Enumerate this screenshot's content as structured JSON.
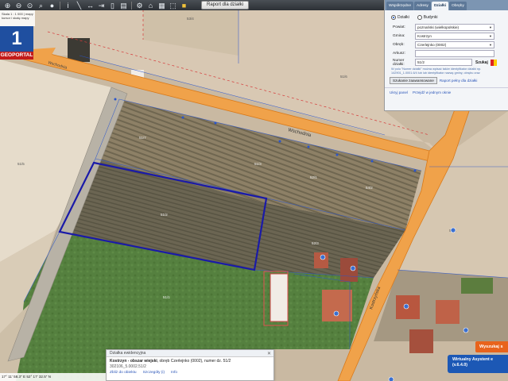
{
  "toolbar": {
    "tools": [
      "zoom-in-icon",
      "zoom-out-icon",
      "zoom-extent-icon",
      "zoom-window-icon",
      "pan-icon",
      "info-icon",
      "measure-icon",
      "area-icon",
      "draw-icon",
      "print-icon",
      "layers-icon",
      "settings-icon",
      "home-icon",
      "table-icon",
      "export-icon",
      "flag-icon"
    ],
    "report_label": "Raport dla działki"
  },
  "scale_strip": {
    "text": "Skala 1 : 1 000 | mapy kursor i skalę mapy"
  },
  "logo": {
    "number": "1",
    "text": "GEOPORTAL"
  },
  "panel": {
    "tabs": [
      "Współrzędne",
      "Adresy",
      "Działki",
      "Obręby"
    ],
    "active_tab": "Działki",
    "radio_options": [
      "Działki",
      "Budynki"
    ],
    "fields": [
      {
        "label": "Powiat:",
        "value": "poznański (wielkopolskie)"
      },
      {
        "label": "Gmina:",
        "value": "Kostrzyn"
      },
      {
        "label": "Obręb:",
        "value": "Czerlejnko (0002)"
      },
      {
        "label": "Arkusz:",
        "value": ""
      }
    ],
    "number_label": "Numer działki:",
    "number_value": "51/2",
    "search_label": "Szukaj",
    "note": "W polu \"Numer działki\" można wpisać także identyfikator działki np. 142901_1.0001.6/4 lub lub identyfikator nazwę gminy, obrębu oraz",
    "advanced_label": "Szukanie zaawansowane",
    "raport_link": "Raport pełny dla działki",
    "links": [
      "Ukryj panel",
      "Przejdź w jednym oknie"
    ]
  },
  "map_labels": {
    "road1": "Wschodnia",
    "road2": "Wschodnia",
    "road3": "Kostrzyńska",
    "parcels": [
      "51/7",
      "51/3",
      "54/2",
      "52/1",
      "51/2",
      "52/3",
      "51/1",
      "51/5",
      "51/6",
      "53/4",
      "53/1",
      "44/3",
      "38/3",
      "31/1",
      "36/2",
      "4/2",
      "51/4",
      "51/8",
      "51/9"
    ]
  },
  "popup": {
    "header": "Działka ewidencyjna",
    "line1_bold": "Kostrzyn - obszar wiejski",
    "line1_rest": ", obręb Czerlejnko (0002), numer dz. 51/2",
    "line2": "302106_5.0002.51/2",
    "actions": [
      "Zbliż do obiektu",
      "Szczegóły (i)",
      "Info"
    ]
  },
  "corner": {
    "orange_label": "Wyszukaj s",
    "blue_line1": "Wirtualny Asystent e",
    "blue_line2": "(v.6.4.0)"
  },
  "statusbar": {
    "text": "17° 11' 58.3\" E   52° 17' 32.5\" N"
  },
  "colors": {
    "road": "#f0a24a",
    "road_edge": "#d97a1a",
    "parcel_line": "#2a55cc",
    "highlight": "#1a1aa8",
    "toolbar": "#2c3035",
    "logo_blue": "#1f4fa0",
    "logo_red": "#c21b1b",
    "orange_button": "#e8631c",
    "blue_button": "#1c58b5"
  }
}
